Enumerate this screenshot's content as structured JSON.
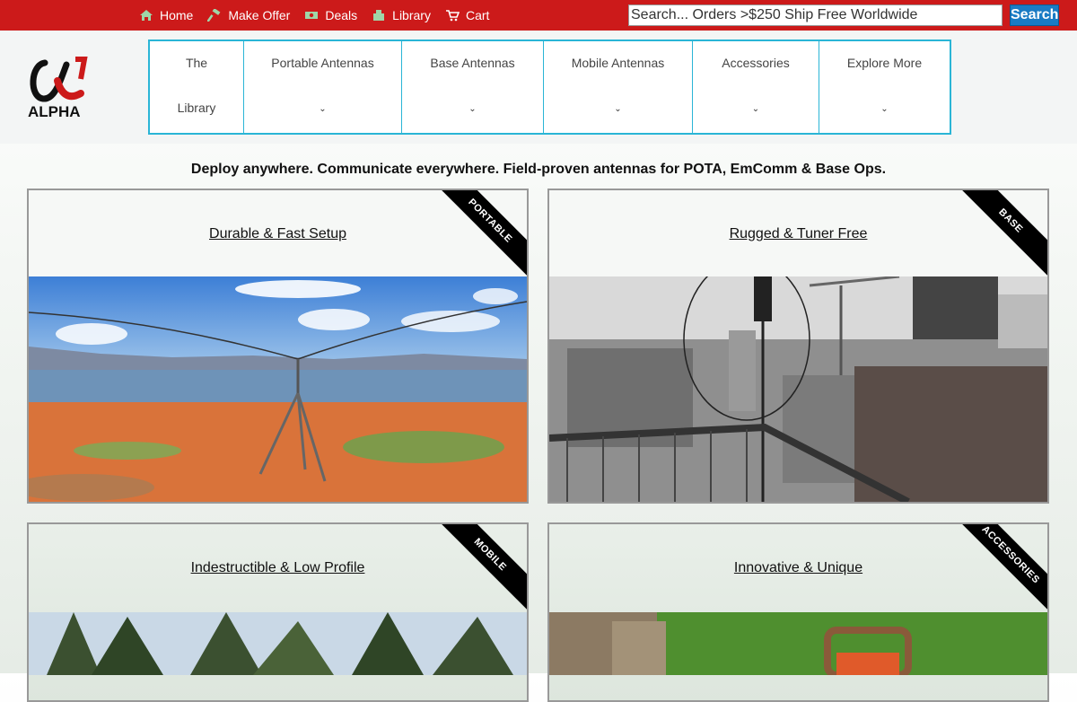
{
  "topnav": {
    "items": [
      {
        "label": "Home",
        "icon": "home-icon"
      },
      {
        "label": "Make Offer",
        "icon": "hammer-icon"
      },
      {
        "label": "Deals",
        "icon": "money-icon"
      },
      {
        "label": "Library",
        "icon": "books-icon"
      },
      {
        "label": "Cart",
        "icon": "cart-icon"
      }
    ],
    "search_placeholder": "Search... Orders >$250 Ship Free Worldwide",
    "search_button": "Search"
  },
  "logo": {
    "text": "ALPHA",
    "symbol": "α"
  },
  "mainnav": {
    "items": [
      {
        "line1": "The",
        "line2": "Library",
        "dropdown": false
      },
      {
        "line1": "Portable Antennas",
        "dropdown": true
      },
      {
        "line1": "Base Antennas",
        "dropdown": true
      },
      {
        "line1": "Mobile Antennas",
        "dropdown": true
      },
      {
        "line1": "Accessories",
        "dropdown": true
      },
      {
        "line1": "Explore More",
        "dropdown": true
      }
    ],
    "chevron": "⌄"
  },
  "tagline": "Deploy anywhere. Communicate everywhere. Field-proven antennas for POTA, EmComm & Base Ops.",
  "cards": [
    {
      "title": "Durable & Fast Setup",
      "ribbon": "PORTABLE"
    },
    {
      "title": "Rugged & Tuner Free",
      "ribbon": "BASE"
    },
    {
      "title": "Indestructible & Low Profile",
      "ribbon": "MOBILE"
    },
    {
      "title": "Innovative & Unique",
      "ribbon": "ACCESSORIES"
    }
  ],
  "colors": {
    "topbar": "#cc1a1a",
    "search_button": "#1a7bc4",
    "nav_border": "#2ab5d6",
    "logo_red": "#cc1a1a"
  }
}
